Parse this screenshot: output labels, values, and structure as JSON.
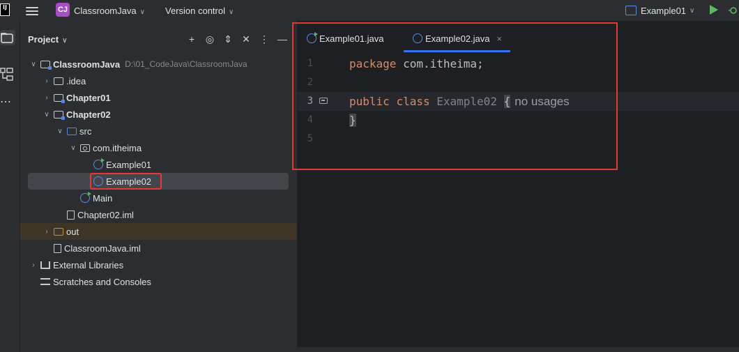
{
  "titlebar": {
    "logo_text": "IJ",
    "project_badge": "CJ",
    "project_name": "ClassroomJava",
    "vcs_label": "Version control",
    "run_config": "Example01"
  },
  "project_panel": {
    "title": "Project",
    "tree": [
      {
        "label": "ClassroomJava",
        "path": "D:\\01_CodeJava\\ClassroomJava"
      },
      {
        "label": ".idea"
      },
      {
        "label": "Chapter01"
      },
      {
        "label": "Chapter02"
      },
      {
        "label": "src"
      },
      {
        "label": "com.itheima"
      },
      {
        "label": "Example01"
      },
      {
        "label": "Example02"
      },
      {
        "label": "Main"
      },
      {
        "label": "Chapter02.iml"
      },
      {
        "label": "out"
      },
      {
        "label": "ClassroomJava.iml"
      },
      {
        "label": "External Libraries"
      },
      {
        "label": "Scratches and Consoles"
      }
    ]
  },
  "editor": {
    "tabs": [
      {
        "label": "Example01.java"
      },
      {
        "label": "Example02.java",
        "close": "×"
      }
    ],
    "lines": [
      "1",
      "2",
      "3",
      "4",
      "5"
    ],
    "code": {
      "kw_package": "package",
      "pkg_name": "com.itheima;",
      "kw_public": "public",
      "kw_class": "class",
      "class_name": "Example02",
      "open_brace": "{",
      "usage_hint": "no usages",
      "close_brace": "}"
    }
  },
  "colors": {
    "accent": "#3574f0",
    "keyword": "#cf8e6d",
    "annotation_box": "#e53935"
  }
}
